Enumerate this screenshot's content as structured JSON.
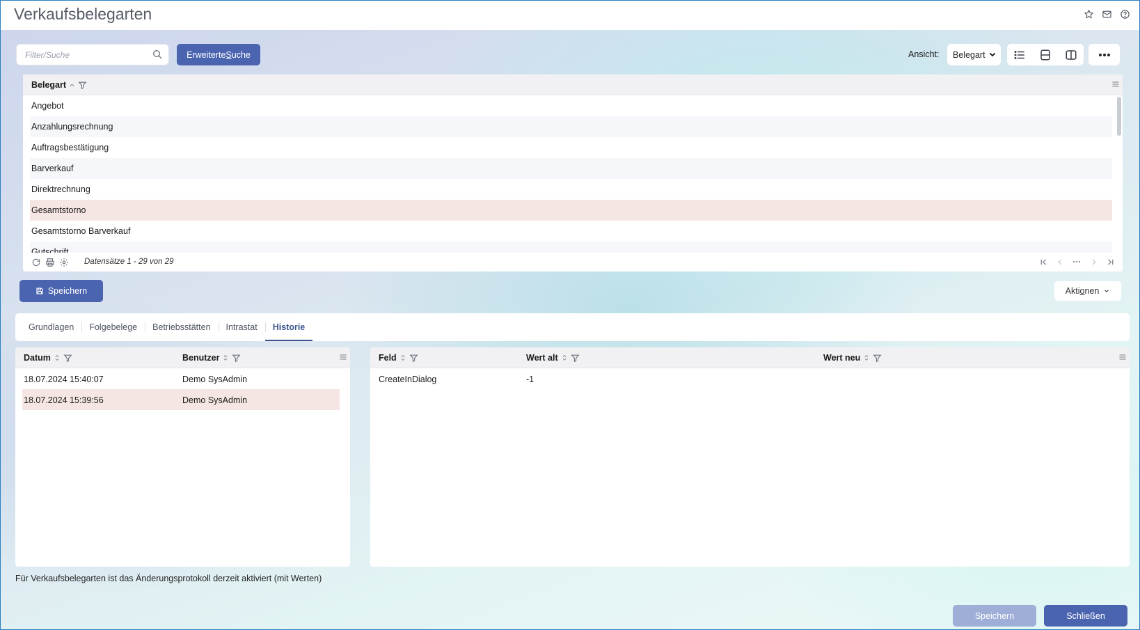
{
  "window": {
    "title": "Verkaufsbelegarten",
    "icons": [
      "star-icon",
      "mail-icon",
      "help-icon"
    ]
  },
  "toolbar": {
    "search_placeholder": "Filter/Suche",
    "advanced_search_label_pre": "Erweiterte ",
    "advanced_search_label_u": "S",
    "advanced_search_label_post": "uche",
    "view_label": "Ansicht:",
    "view_value": "Belegart"
  },
  "top_grid": {
    "column": "Belegart",
    "rows": [
      "Angebot",
      "Anzahlungsrechnung",
      "Auftragsbestätigung",
      "Barverkauf",
      "Direktrechnung",
      "Gesamtstorno",
      "Gesamtstorno Barverkauf",
      "Gutschrift"
    ],
    "selected_index": 5,
    "record_info": "Datensätze 1 - 29 von 29"
  },
  "actions": {
    "save_label": "Speichern",
    "actions_label_pre": "Akti",
    "actions_label_u": "o",
    "actions_label_post": "nen"
  },
  "tabs": [
    "Grundlagen",
    "Folgebelege",
    "Betriebsstätten",
    "Intrastat",
    "Historie"
  ],
  "active_tab": "Historie",
  "history_grid": {
    "columns": [
      "Datum",
      "Benutzer"
    ],
    "rows": [
      {
        "datum": "18.07.2024 15:40:07",
        "benutzer": "Demo SysAdmin"
      },
      {
        "datum": "18.07.2024 15:39:56",
        "benutzer": "Demo SysAdmin"
      }
    ]
  },
  "detail_grid": {
    "columns": [
      "Feld",
      "Wert alt",
      "Wert neu"
    ],
    "rows": [
      {
        "feld": "CreateInDialog",
        "wert_alt": "-1",
        "wert_neu": ""
      }
    ]
  },
  "footnote": "Für Verkaufsbelegarten ist das Änderungsprotokoll derzeit aktiviert (mit Werten)",
  "bottom": {
    "save_label": "Speichern",
    "close_label": "Schließen"
  }
}
